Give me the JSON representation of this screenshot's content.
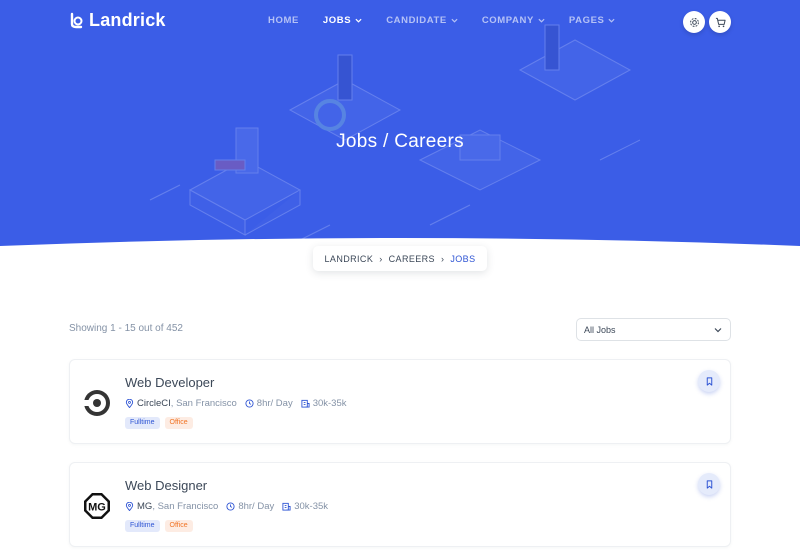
{
  "brand": {
    "name": "Landrick"
  },
  "nav": {
    "items": [
      {
        "label": "HOME",
        "active": false,
        "dropdown": false
      },
      {
        "label": "JOBS",
        "active": true,
        "dropdown": true
      },
      {
        "label": "CANDIDATE",
        "active": false,
        "dropdown": true
      },
      {
        "label": "COMPANY",
        "active": false,
        "dropdown": true
      },
      {
        "label": "PAGES",
        "active": false,
        "dropdown": true
      }
    ],
    "icons": [
      "settings-icon",
      "cart-icon"
    ]
  },
  "hero": {
    "title": "Jobs / Careers"
  },
  "breadcrumb": {
    "items": [
      "LANDRICK",
      "CAREERS"
    ],
    "current": "JOBS"
  },
  "results": {
    "showing": "Showing 1 - 15 out of 452"
  },
  "filter": {
    "selected": "All Jobs"
  },
  "jobs": [
    {
      "title": "Web Developer",
      "company": "CircleCI",
      "location": "San Francisco",
      "hours": "8hr/ Day",
      "salary": "30k-35k",
      "badges": [
        "Fulltime",
        "Office"
      ],
      "logo_icon": "circleci-logo-icon"
    },
    {
      "title": "Web Designer",
      "company": "MG",
      "location": "San Francisco",
      "hours": "8hr/ Day",
      "salary": "30k-35k",
      "badges": [
        "Fulltime",
        "Office"
      ],
      "logo_icon": "mg-logo-icon"
    }
  ],
  "colors": {
    "primary": "#2f55d4",
    "hero_bg": "#3b5de7",
    "muted": "#8492a6",
    "text": "#3c4858",
    "badge_orange": "#f17425"
  }
}
